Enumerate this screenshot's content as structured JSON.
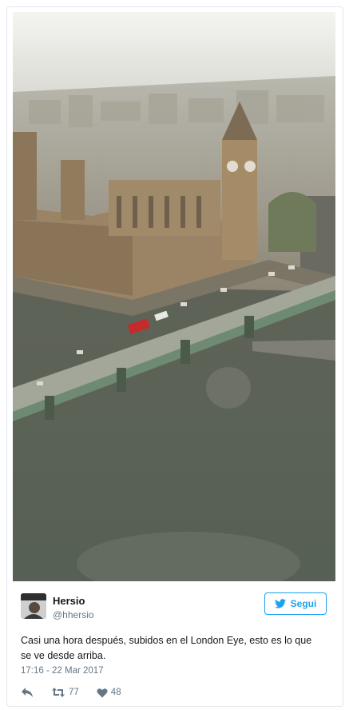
{
  "photo": {
    "alt": "Vista aérea del Palacio de Westminster y el puente de Westminster"
  },
  "author": {
    "name": "Hersio",
    "handle": "@hhersio"
  },
  "follow_button": {
    "label": "Segui"
  },
  "tweet": {
    "text": "Casi una hora después, subidos en el London Eye, esto es lo que se ve desde arriba.",
    "timestamp": "17:16 - 22 Mar 2017"
  },
  "actions": {
    "retweets": "77",
    "likes": "48"
  },
  "colors": {
    "accent": "#1da1f2",
    "muted": "#657786",
    "border": "#e1e8ed"
  },
  "icons": [
    "reply-icon",
    "retweet-icon",
    "heart-icon",
    "twitter-bird-icon"
  ]
}
